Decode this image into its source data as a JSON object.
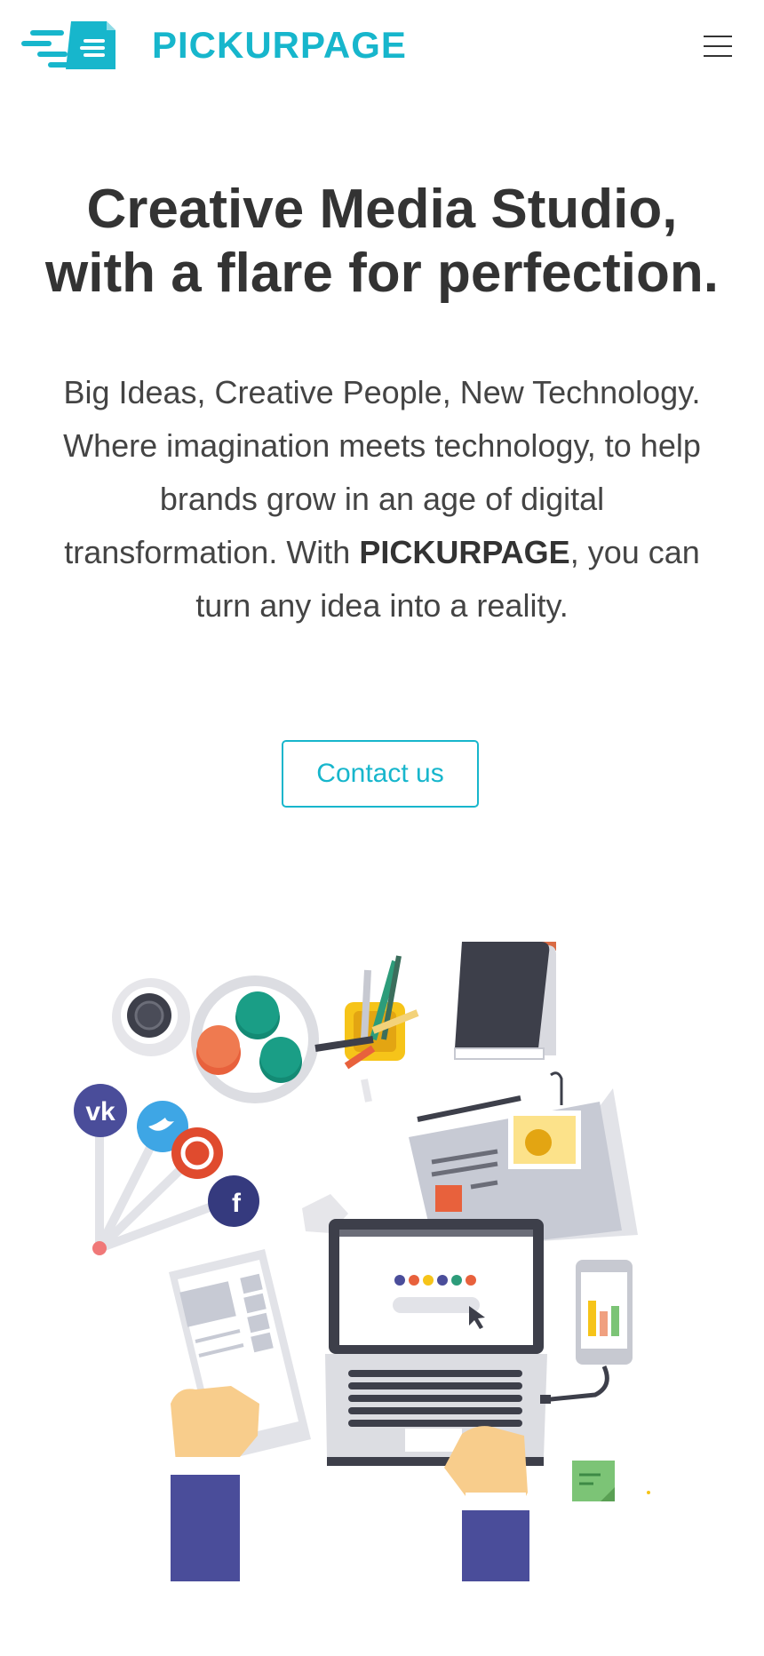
{
  "header": {
    "logo_text": "PICKURPAGE",
    "menu_icon": "hamburger-menu-icon"
  },
  "hero": {
    "title_line1": "Creative Media Studio,",
    "title_line2": "with a flare for perfection.",
    "tagline": "Big Ideas, Creative People, New Technology.",
    "body_before": "Where imagination meets technology, to help brands grow in an age of digital transformation. With ",
    "body_brand": "PICKURPAGE",
    "body_after": ", you can turn any idea into a reality.",
    "cta_label": "Contact us"
  },
  "colors": {
    "brand": "#17b6cc",
    "text": "#333333",
    "navy": "#4a4d9a"
  },
  "illustration": {
    "icons": [
      "vk-icon",
      "twitter-icon",
      "pinterest-icon",
      "facebook-icon",
      "laptop-icon",
      "tablet-icon",
      "phone-icon",
      "notebook-icon",
      "coffee-cup-icon",
      "pencils-icon",
      "newspaper-icon",
      "sticky-note-icon"
    ]
  }
}
